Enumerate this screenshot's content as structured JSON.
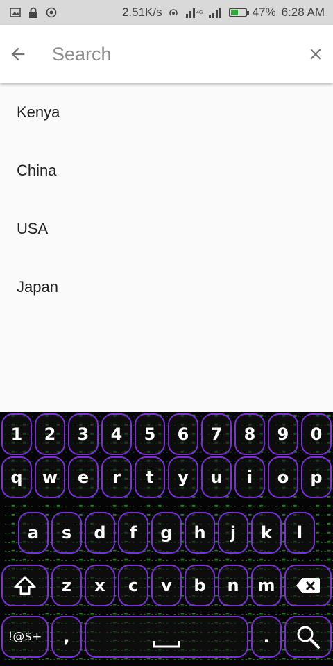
{
  "status_bar": {
    "speed": "2.51K/s",
    "battery": "47%",
    "battery_level": 0.47,
    "time": "6:28 AM",
    "icons": [
      "image-icon",
      "lock-icon",
      "sync-icon",
      "hotspot-icon",
      "signal-icon",
      "signal-icon",
      "battery-icon"
    ]
  },
  "app_bar": {
    "search_placeholder": "Search",
    "search_value": "",
    "accent_color": "#8e24aa"
  },
  "countries": [
    "Kenya",
    "China",
    "USA",
    "Japan"
  ],
  "keyboard": {
    "row_numbers": [
      "1",
      "2",
      "3",
      "4",
      "5",
      "6",
      "7",
      "8",
      "9",
      "0"
    ],
    "row1": [
      "q",
      "w",
      "e",
      "r",
      "t",
      "y",
      "u",
      "i",
      "o",
      "p"
    ],
    "row2": [
      "a",
      "s",
      "d",
      "f",
      "g",
      "h",
      "j",
      "k",
      "l"
    ],
    "row3": [
      "z",
      "x",
      "c",
      "v",
      "b",
      "n",
      "m"
    ],
    "shift": "shift-icon",
    "backspace": "backspace-icon",
    "symbols_label": "!@$+",
    "comma_label": ",",
    "period_label": ".",
    "search_key": "search-icon",
    "border_color": "#7b2fd6"
  }
}
